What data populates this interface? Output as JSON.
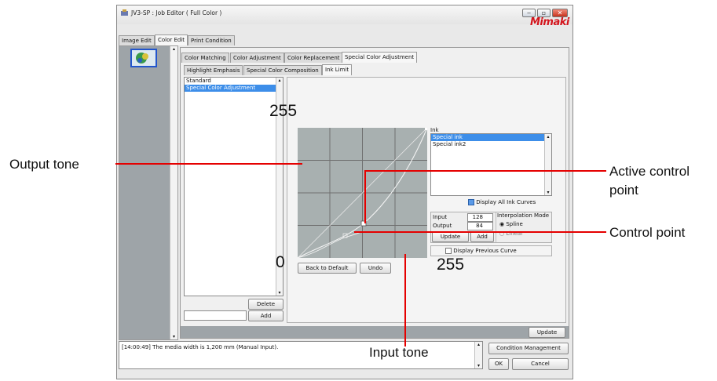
{
  "window": {
    "title": "JV3-SP : Job Editor ( Full Color )",
    "logo_text": "Mimaki",
    "controls": [
      "minimize",
      "maximize",
      "close"
    ]
  },
  "main_tabs": [
    "Image Edit",
    "Color Edit",
    "Print Condition"
  ],
  "sub_tabs": [
    "Color Matching",
    "Color Adjustment",
    "Color Replacement",
    "Special Color Adjustment"
  ],
  "sub_sub_tabs": [
    "Highlight Emphasis",
    "Special Color Composition",
    "Ink Limit"
  ],
  "settings_list": [
    "Standard",
    "Special Color Adjustment"
  ],
  "settings_buttons": {
    "delete": "Delete",
    "add": "Add"
  },
  "graph": {
    "y_max_label": "255",
    "origin_label": "0",
    "x_max_label": "255",
    "back_to_default": "Back to Default",
    "undo": "Undo"
  },
  "ink_panel": {
    "label": "Ink",
    "items": [
      "Special ink",
      "Special ink2"
    ],
    "display_all_label": "Display All Ink Curves",
    "input_label": "Input",
    "input_value": "128",
    "output_label": "Output",
    "output_value": "84",
    "update_label": "Update",
    "add_label": "Add",
    "interp_label": "Interpolation Mode",
    "spline_label": "Spline",
    "linear_label": "Linear",
    "display_prev_label": "Display Previous Curve"
  },
  "update_button": "Update",
  "status_message": "[14:00:49] The media width is 1,200 mm (Manual Input).",
  "condition_management": "Condition Management",
  "ok": "OK",
  "cancel": "Cancel",
  "callouts": {
    "output_tone": "Output tone",
    "active_line1": "Active control",
    "active_line2": "point",
    "control_point": "Control point",
    "input_tone": "Input tone"
  },
  "colors": {
    "callout_line": "#e50000",
    "selection": "#3d8ee9",
    "graph_bg": "#a8b0b0"
  }
}
